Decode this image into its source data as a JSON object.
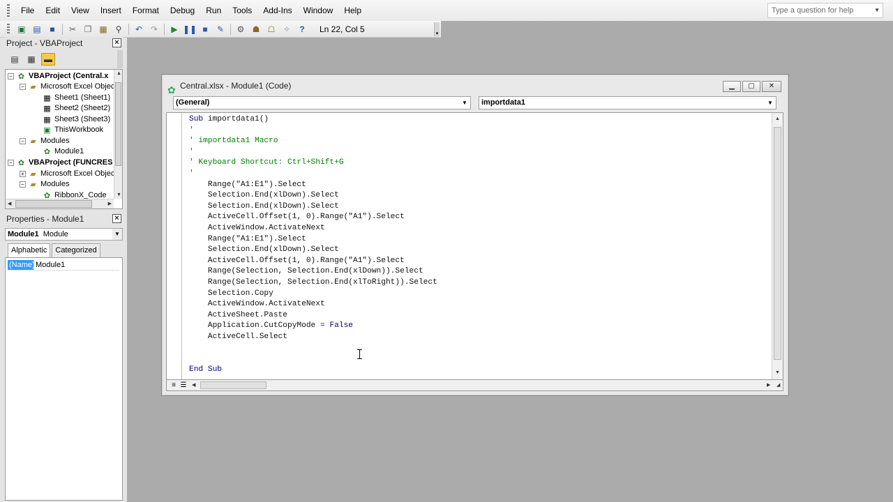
{
  "menu": [
    "File",
    "Edit",
    "View",
    "Insert",
    "Format",
    "Debug",
    "Run",
    "Tools",
    "Add-Ins",
    "Window",
    "Help"
  ],
  "help_placeholder": "Type a question for help",
  "toolbar": {
    "position": "Ln 22, Col 5"
  },
  "project": {
    "title": "Project - VBAProject",
    "tree": [
      "VBAProject (Central.x",
      "Microsoft Excel Objec",
      "Sheet1 (Sheet1)",
      "Sheet2 (Sheet2)",
      "Sheet3 (Sheet3)",
      "ThisWorkbook",
      "Modules",
      "Module1",
      "VBAProject (FUNCRES",
      "Microsoft Excel Objec",
      "Modules",
      "RibbonX_Code"
    ]
  },
  "properties": {
    "title": "Properties - Module1",
    "object_name": "Module1",
    "object_type": "Module",
    "tabs": [
      "Alphabetic",
      "Categorized"
    ],
    "key": "(Name)",
    "value": "Module1"
  },
  "codewin": {
    "title": "Central.xlsx - Module1 (Code)",
    "object_combo": "(General)",
    "proc_combo": "importdata1"
  },
  "code": {
    "sub_keyword": "Sub",
    "sub_name": " importdata1()",
    "lines": [
      "'",
      "' importdata1 Macro",
      "'",
      "' Keyboard Shortcut: Ctrl+Shift+G",
      "'",
      "    Range(\"A1:E1\").Select",
      "    Selection.End(xlDown).Select",
      "    Selection.End(xlDown).Select",
      "    ActiveCell.Offset(1, 0).Range(\"A1\").Select",
      "    ActiveWindow.ActivateNext",
      "    Range(\"A1:E1\").Select",
      "    Selection.End(xlDown).Select",
      "    ActiveCell.Offset(1, 0).Range(\"A1\").Select",
      "    Range(Selection, Selection.End(xlDown)).Select",
      "    Range(Selection, Selection.End(xlToRight)).Select",
      "    Selection.Copy",
      "    ActiveWindow.ActivateNext",
      "    ActiveSheet.Paste"
    ],
    "cutcopy_prefix": "    Application.CutCopyMode = ",
    "cutcopy_value": "False",
    "last_statement": "    ActiveCell.Select",
    "blank": "",
    "end_sub": "End Sub"
  }
}
